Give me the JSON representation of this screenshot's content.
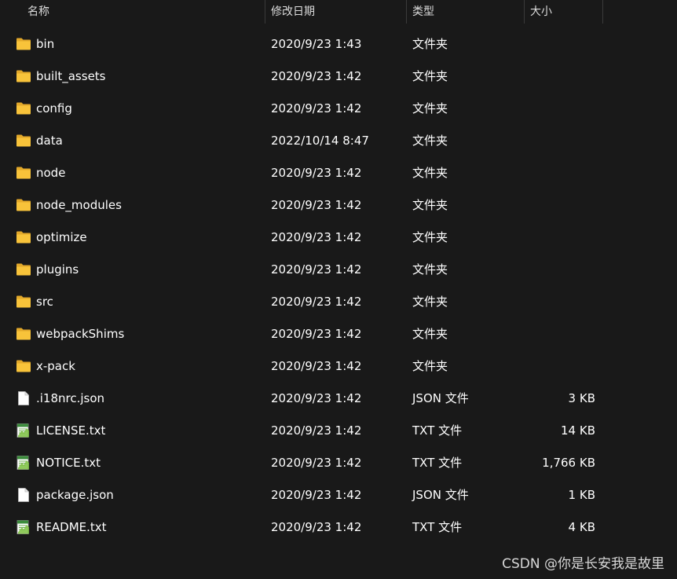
{
  "header": {
    "name": "名称",
    "date": "修改日期",
    "type": "类型",
    "size": "大小",
    "sort_caret": "^"
  },
  "rows": [
    {
      "name": "bin",
      "date": "2020/9/23 1:43",
      "type": "文件夹",
      "size": "",
      "icon": "folder-icon"
    },
    {
      "name": "built_assets",
      "date": "2020/9/23 1:42",
      "type": "文件夹",
      "size": "",
      "icon": "folder-icon"
    },
    {
      "name": "config",
      "date": "2020/9/23 1:42",
      "type": "文件夹",
      "size": "",
      "icon": "folder-icon"
    },
    {
      "name": "data",
      "date": "2022/10/14 8:47",
      "type": "文件夹",
      "size": "",
      "icon": "folder-icon"
    },
    {
      "name": "node",
      "date": "2020/9/23 1:42",
      "type": "文件夹",
      "size": "",
      "icon": "folder-icon"
    },
    {
      "name": "node_modules",
      "date": "2020/9/23 1:42",
      "type": "文件夹",
      "size": "",
      "icon": "folder-icon"
    },
    {
      "name": "optimize",
      "date": "2020/9/23 1:42",
      "type": "文件夹",
      "size": "",
      "icon": "folder-icon"
    },
    {
      "name": "plugins",
      "date": "2020/9/23 1:42",
      "type": "文件夹",
      "size": "",
      "icon": "folder-icon"
    },
    {
      "name": "src",
      "date": "2020/9/23 1:42",
      "type": "文件夹",
      "size": "",
      "icon": "folder-icon"
    },
    {
      "name": "webpackShims",
      "date": "2020/9/23 1:42",
      "type": "文件夹",
      "size": "",
      "icon": "folder-icon"
    },
    {
      "name": "x-pack",
      "date": "2020/9/23 1:42",
      "type": "文件夹",
      "size": "",
      "icon": "folder-icon"
    },
    {
      "name": ".i18nrc.json",
      "date": "2020/9/23 1:42",
      "type": "JSON 文件",
      "size": "3 KB",
      "icon": "file-icon"
    },
    {
      "name": "LICENSE.txt",
      "date": "2020/9/23 1:42",
      "type": "TXT 文件",
      "size": "14 KB",
      "icon": "text-file-icon"
    },
    {
      "name": "NOTICE.txt",
      "date": "2020/9/23 1:42",
      "type": "TXT 文件",
      "size": "1,766 KB",
      "icon": "text-file-icon"
    },
    {
      "name": "package.json",
      "date": "2020/9/23 1:42",
      "type": "JSON 文件",
      "size": "1 KB",
      "icon": "file-icon"
    },
    {
      "name": "README.txt",
      "date": "2020/9/23 1:42",
      "type": "TXT 文件",
      "size": "4 KB",
      "icon": "text-file-icon"
    }
  ],
  "watermark": "CSDN @你是长安我是故里",
  "colors": {
    "background": "#191919",
    "folder": "#f8c33a",
    "folder_dark": "#e2a82a",
    "text": "#ffffff"
  }
}
